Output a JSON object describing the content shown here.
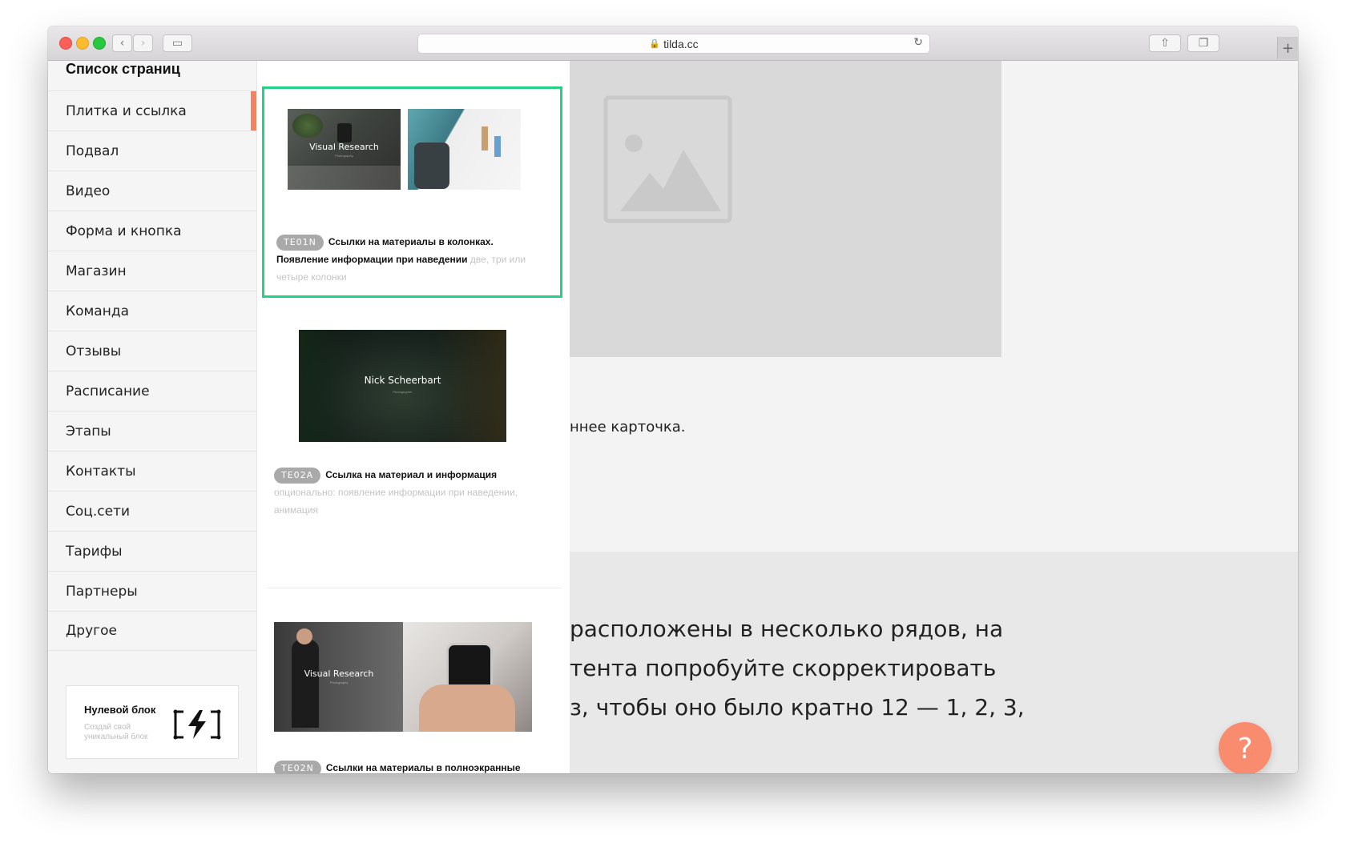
{
  "browser": {
    "url": "tilda.cc",
    "lock_icon": "🔒",
    "reload_icon": "↻",
    "back_icon": "‹",
    "forward_icon": "›",
    "sidebar_toggle_icon": "▭",
    "share_icon": "⇧",
    "tabs_icon": "❐",
    "new_tab_icon": "+"
  },
  "sidebar": {
    "title": "Список страниц",
    "items": [
      {
        "label": "Плитка и ссылка",
        "active": true
      },
      {
        "label": "Подвал"
      },
      {
        "label": "Видео"
      },
      {
        "label": "Форма и кнопка"
      },
      {
        "label": "Магазин"
      },
      {
        "label": "Команда"
      },
      {
        "label": "Отзывы"
      },
      {
        "label": "Расписание"
      },
      {
        "label": "Этапы"
      },
      {
        "label": "Контакты"
      },
      {
        "label": "Соц.сети"
      },
      {
        "label": "Тарифы"
      },
      {
        "label": "Партнеры"
      },
      {
        "label": "Другое"
      }
    ],
    "zero_block": {
      "title": "Нулевой блок",
      "subtitle": "Создай свой уникальный блок"
    }
  },
  "blocks": [
    {
      "code": "TE01N",
      "name": "Ссылки на материалы в колонках. Появление информации при наведении",
      "hint": "две, три или четыре колонки",
      "thumb_label": "Visual Research",
      "thumb_sublabel": "Photography"
    },
    {
      "code": "TE02A",
      "name": "Ссылка на материал и информация",
      "hint": "опционально: появление информации при наведении, анимация",
      "thumb_label": "Nick Scheerbart",
      "thumb_sublabel": "Photographer"
    },
    {
      "code": "TE02N",
      "name": "Ссылки на материалы в полноэкранные",
      "hint": "",
      "thumb_label": "Visual Research",
      "thumb_sublabel": "Photography"
    }
  ],
  "background_page": {
    "card_text": "ннее карточка.",
    "paragraph": [
      "расположены в несколько рядов, на",
      "тента попробуйте скорректировать",
      "з, чтобы оно было кратно 12 — 1, 2, 3,"
    ],
    "help_icon": "?"
  },
  "colors": {
    "selected_border": "#23d282",
    "active_marker": "#f3835f",
    "help_button": "#f98b6e",
    "badge": "#a9a9a9"
  }
}
